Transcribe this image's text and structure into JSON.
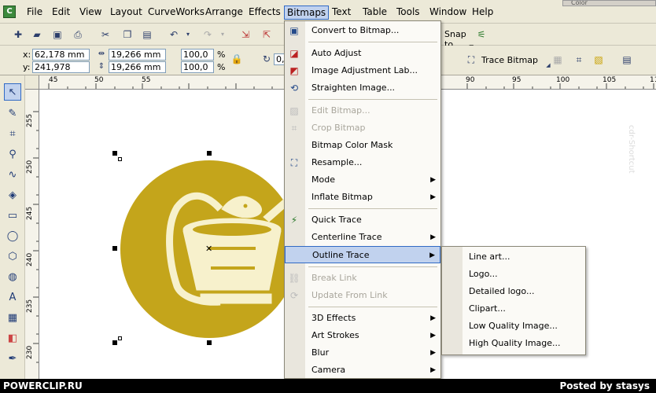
{
  "menubar": {
    "items": [
      "File",
      "Edit",
      "View",
      "Layout",
      "CurveWorks",
      "Arrange",
      "Effects",
      "Bitmaps",
      "Text",
      "Table",
      "Tools",
      "Window",
      "Help"
    ],
    "active_index": 7,
    "top_right": "Color"
  },
  "toolbar2": {
    "x_label": "x:",
    "x_value": "62,178 mm",
    "y_label": "y:",
    "y_value": "241,978 mm",
    "w_value": "19,266 mm",
    "h_value": "19,266 mm",
    "scale_x": "100,0",
    "scale_y": "100,0",
    "pct1": "%",
    "pct2": "%",
    "rotation": "0,",
    "trace_bitmap_label": "Trace Bitmap"
  },
  "toolbar1": {
    "snap_to_label": "Snap to"
  },
  "ruler": {
    "h_ticks": [
      "45",
      "50",
      "55",
      "90",
      "95",
      "100",
      "105",
      "11"
    ],
    "v_ticks": [
      "255",
      "250",
      "245",
      "240",
      "235",
      "230"
    ]
  },
  "bitmaps_menu": {
    "items": [
      {
        "label": "Convert to Bitmap...",
        "disabled": false,
        "submenu": false,
        "icon": "convert-bitmap-icon"
      },
      {
        "label": "Auto Adjust",
        "disabled": false,
        "submenu": false,
        "icon": "auto-adjust-icon"
      },
      {
        "label": "Image Adjustment Lab...",
        "disabled": false,
        "submenu": false,
        "icon": "adjustment-lab-icon"
      },
      {
        "label": "Straighten Image...",
        "disabled": false,
        "submenu": false,
        "icon": "straighten-icon"
      },
      {
        "label": "Edit Bitmap...",
        "disabled": true,
        "submenu": false,
        "icon": "edit-bitmap-icon"
      },
      {
        "label": "Crop Bitmap",
        "disabled": true,
        "submenu": false,
        "icon": "crop-bitmap-icon"
      },
      {
        "label": "Bitmap Color Mask",
        "disabled": false,
        "submenu": false,
        "icon": ""
      },
      {
        "label": "Resample...",
        "disabled": false,
        "submenu": false,
        "icon": "resample-icon"
      },
      {
        "label": "Mode",
        "disabled": false,
        "submenu": true,
        "icon": ""
      },
      {
        "label": "Inflate Bitmap",
        "disabled": false,
        "submenu": true,
        "icon": ""
      },
      {
        "label": "Quick Trace",
        "disabled": false,
        "submenu": false,
        "icon": "quick-trace-icon"
      },
      {
        "label": "Centerline Trace",
        "disabled": false,
        "submenu": true,
        "icon": ""
      },
      {
        "label": "Outline Trace",
        "disabled": false,
        "submenu": true,
        "icon": ""
      },
      {
        "label": "Break Link",
        "disabled": true,
        "submenu": false,
        "icon": "break-link-icon"
      },
      {
        "label": "Update From Link",
        "disabled": true,
        "submenu": false,
        "icon": "update-link-icon"
      },
      {
        "label": "3D Effects",
        "disabled": false,
        "submenu": true,
        "icon": ""
      },
      {
        "label": "Art Strokes",
        "disabled": false,
        "submenu": true,
        "icon": ""
      },
      {
        "label": "Blur",
        "disabled": false,
        "submenu": true,
        "icon": ""
      },
      {
        "label": "Camera",
        "disabled": false,
        "submenu": true,
        "icon": ""
      }
    ],
    "highlighted_index": 12
  },
  "outline_submenu": {
    "items": [
      "Line art...",
      "Logo...",
      "Detailed logo...",
      "Clipart...",
      "Low Quality Image...",
      "High Quality Image..."
    ]
  },
  "watermark_left": "POWERCLIP.RU",
  "watermark_right": "Posted by stasys",
  "side_text": "cdr-Shortcut"
}
